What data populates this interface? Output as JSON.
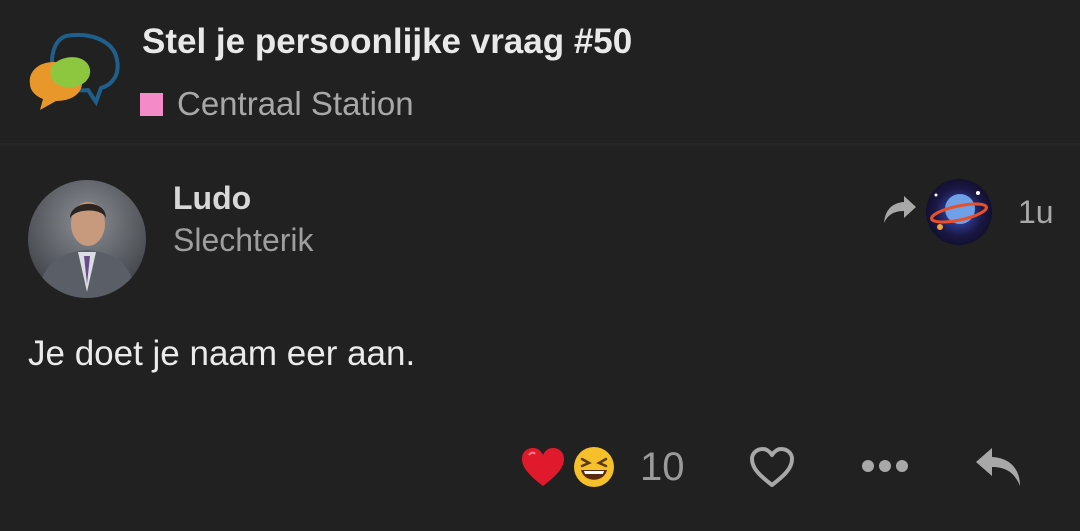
{
  "topic": {
    "title": "Stel je persoonlijke vraag #50",
    "category": {
      "name": "Centraal Station",
      "color": "#f58ac8"
    }
  },
  "post": {
    "username": "Ludo",
    "user_title": "Slechterik",
    "date": "1u",
    "body": "Je doet je naam eer aan.",
    "reactions": {
      "icons": [
        "heart-emoji",
        "laughing-emoji"
      ],
      "count": "10"
    }
  },
  "icons": {
    "site_logo": "speech-bubbles-logo",
    "reply_to": "share-arrow-icon",
    "like": "heart-outline-icon",
    "more": "ellipsis-icon",
    "reply": "reply-arrow-icon"
  },
  "colors": {
    "background": "#212121",
    "heart": "#e0192c",
    "emoji_yellow": "#f6c02b"
  }
}
